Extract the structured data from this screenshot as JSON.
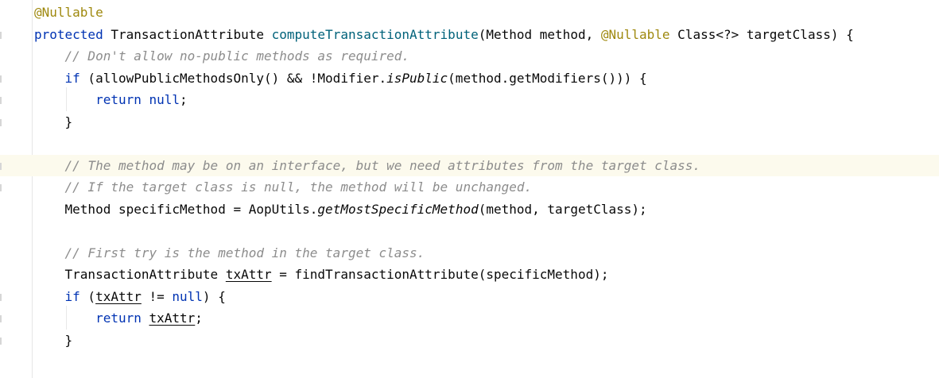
{
  "editor": {
    "lines": [
      {
        "tokens": [
          [
            "@Nullable",
            "ann"
          ]
        ]
      },
      {
        "tokens": [
          [
            "protected",
            "kw"
          ],
          [
            " TransactionAttribute ",
            ""
          ],
          [
            "computeTransactionAttribute",
            "fn"
          ],
          [
            "(Method method, ",
            ""
          ],
          [
            "@Nullable",
            "ann"
          ],
          [
            " Class<?> targetClass) {",
            ""
          ]
        ]
      },
      {
        "tokens": [
          [
            "    // Don't allow no-public methods as required.",
            "cm"
          ]
        ]
      },
      {
        "tokens": [
          [
            "    ",
            ""
          ],
          [
            "if",
            "kw"
          ],
          [
            " (allowPublicMethodsOnly() && !Modifier.",
            ""
          ],
          [
            "isPublic",
            "it"
          ],
          [
            "(method.getModifiers())) {",
            ""
          ]
        ]
      },
      {
        "tokens": [
          [
            "        ",
            ""
          ],
          [
            "return",
            "kw"
          ],
          [
            " ",
            ""
          ],
          [
            "null",
            "kw"
          ],
          [
            ";",
            ""
          ]
        ]
      },
      {
        "tokens": [
          [
            "    }",
            ""
          ]
        ]
      },
      {
        "tokens": []
      },
      {
        "tokens": [
          [
            "    // The method may be on an interface, but we need attributes from the target class.",
            "cm"
          ]
        ]
      },
      {
        "tokens": [
          [
            "    // If the target class is null, the method will be unchanged.",
            "cm"
          ]
        ]
      },
      {
        "tokens": [
          [
            "    Method specificMethod = AopUtils.",
            ""
          ],
          [
            "getMostSpecificMethod",
            "it"
          ],
          [
            "(method, targetClass);",
            ""
          ]
        ]
      },
      {
        "tokens": []
      },
      {
        "tokens": [
          [
            "    // First try is the method in the target class.",
            "cm"
          ]
        ]
      },
      {
        "tokens": [
          [
            "    TransactionAttribute ",
            ""
          ],
          [
            "txAttr",
            "ul"
          ],
          [
            " = findTransactionAttribute(specificMethod);",
            ""
          ]
        ]
      },
      {
        "tokens": [
          [
            "    ",
            ""
          ],
          [
            "if",
            "kw"
          ],
          [
            " (",
            ""
          ],
          [
            "txAttr",
            "ul"
          ],
          [
            " != ",
            ""
          ],
          [
            "null",
            "kw"
          ],
          [
            ") {",
            ""
          ]
        ]
      },
      {
        "tokens": [
          [
            "        ",
            ""
          ],
          [
            "return",
            "kw"
          ],
          [
            " ",
            ""
          ],
          [
            "txAttr",
            "ul"
          ],
          [
            ";",
            ""
          ]
        ]
      },
      {
        "tokens": [
          [
            "    }",
            ""
          ]
        ]
      },
      {
        "tokens": []
      },
      {
        "tokens": [
          [
            "    //",
            "cm"
          ]
        ]
      }
    ],
    "highlighted_line": 7,
    "colors": {
      "keyword": "#0033b3",
      "annotation": "#9e880d",
      "method_decl": "#00627a",
      "comment": "#8c8c8c",
      "text": "#080808",
      "current_line_bg": "#fcfaed"
    }
  }
}
